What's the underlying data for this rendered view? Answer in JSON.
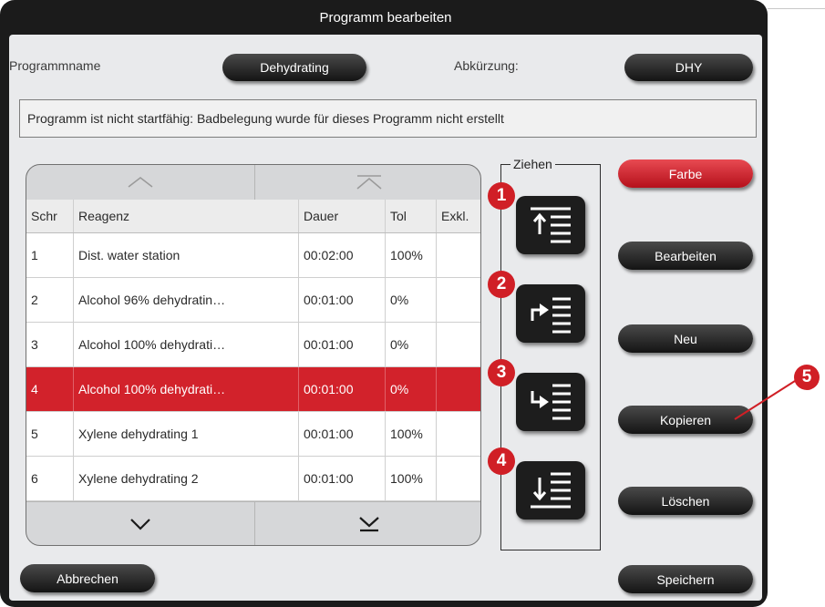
{
  "window": {
    "title": "Programm bearbeiten"
  },
  "program": {
    "name_label": "Programmname",
    "name_value": "Dehydrating",
    "abbr_label": "Abkürzung:",
    "abbr_value": "DHY"
  },
  "message": "Programm ist nicht startfähig: Badbelegung wurde für dieses Programm nicht erstellt",
  "table": {
    "headers": [
      "Schr",
      "Reagenz",
      "Dauer",
      "Tol",
      "Exkl."
    ],
    "rows": [
      {
        "step": "1",
        "reagent": "Dist. water station",
        "duration": "00:02:00",
        "tol": "100%",
        "excl": ""
      },
      {
        "step": "2",
        "reagent": "Alcohol 96% dehydratin…",
        "duration": "00:01:00",
        "tol": "0%",
        "excl": ""
      },
      {
        "step": "3",
        "reagent": "Alcohol 100% dehydrati…",
        "duration": "00:01:00",
        "tol": "0%",
        "excl": ""
      },
      {
        "step": "4",
        "reagent": "Alcohol 100% dehydrati…",
        "duration": "00:01:00",
        "tol": "0%",
        "excl": ""
      },
      {
        "step": "5",
        "reagent": "Xylene dehydrating 1",
        "duration": "00:01:00",
        "tol": "100%",
        "excl": ""
      },
      {
        "step": "6",
        "reagent": "Xylene dehydrating 2",
        "duration": "00:01:00",
        "tol": "100%",
        "excl": ""
      }
    ],
    "selected_row": 4
  },
  "move_group": {
    "label": "Ziehen",
    "markers": [
      "1",
      "2",
      "3",
      "4"
    ]
  },
  "actions": {
    "color": "Farbe",
    "edit": "Bearbeiten",
    "new": "Neu",
    "copy": "Kopieren",
    "delete": "Löschen",
    "save": "Speichern",
    "cancel": "Abbrechen"
  },
  "callout": {
    "number": "5"
  },
  "colors": {
    "accent_red": "#d2222b",
    "marker_red": "#d01f26",
    "button_dark": "#1d1d1d"
  }
}
